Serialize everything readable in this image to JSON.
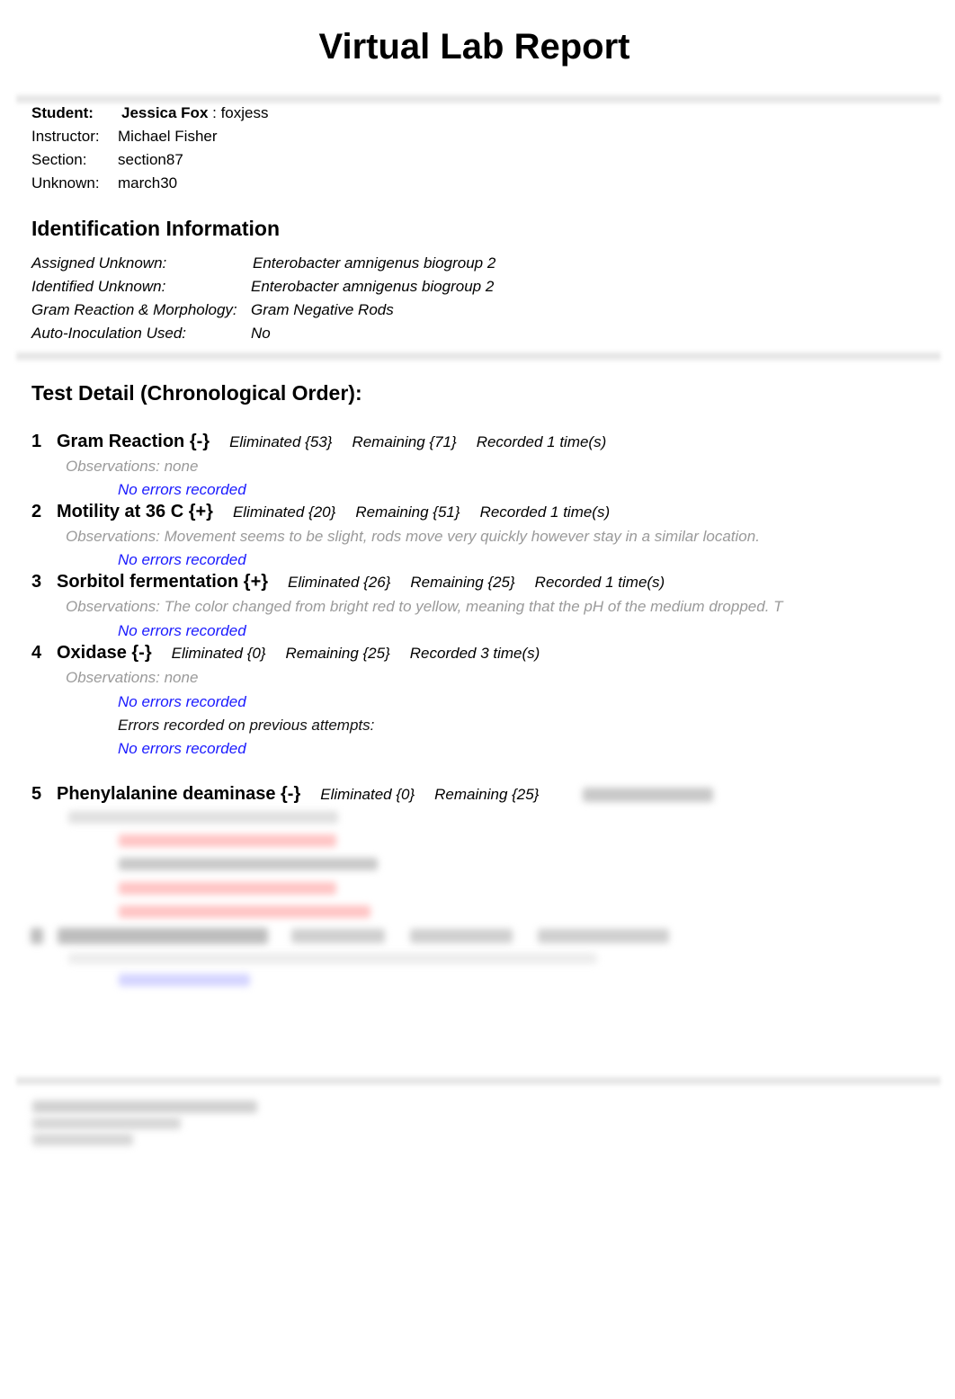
{
  "title": "Virtual Lab Report",
  "student_info": {
    "student_label": "Student:",
    "student_name": "Jessica Fox",
    "student_sep": " : ",
    "student_id": "foxjess",
    "instructor_label": "Instructor:",
    "instructor": "Michael Fisher",
    "section_label": "Section:",
    "section": "section87",
    "unknown_label": "Unknown:",
    "unknown": "march30"
  },
  "identification": {
    "heading": "Identification Information",
    "rows": [
      {
        "label": "Assigned Unknown:",
        "value": "Enterobacter amnigenus biogroup 2"
      },
      {
        "label": "Identified Unknown:",
        "value": "Enterobacter amnigenus biogroup 2"
      },
      {
        "label": "Gram Reaction & Morphology:",
        "value": "Gram Negative Rods"
      },
      {
        "label": "Auto-Inoculation Used:",
        "value": "No"
      }
    ]
  },
  "test_detail": {
    "heading": "Test Detail (Chronological Order):",
    "tests": [
      {
        "num": "1",
        "name": "Gram Reaction {-}",
        "eliminated": "Eliminated {53}",
        "remaining": "Remaining {71}",
        "recorded": "Recorded 1 time(s)",
        "observations": "Observations: none",
        "errors": "No errors recorded"
      },
      {
        "num": "2",
        "name": "Motility at 36 C {+}",
        "eliminated": "Eliminated {20}",
        "remaining": "Remaining {51}",
        "recorded": "Recorded 1 time(s)",
        "observations": "Observations: Movement seems to be slight, rods move very quickly however stay in a similar location.",
        "errors": "No errors recorded"
      },
      {
        "num": "3",
        "name": "Sorbitol fermentation {+}",
        "eliminated": "Eliminated {26}",
        "remaining": "Remaining {25}",
        "recorded": "Recorded 1 time(s)",
        "observations": "Observations: The color changed from bright red to yellow, meaning that the pH of the medium dropped. T",
        "errors": "No errors recorded"
      },
      {
        "num": "4",
        "name": "Oxidase {-}",
        "eliminated": "Eliminated {0}",
        "remaining": "Remaining {25}",
        "recorded": "Recorded 3 time(s)",
        "observations": "Observations: none",
        "errors": "No errors recorded",
        "previous_errors_label": "Errors recorded on previous attempts:",
        "previous_errors": "No errors recorded"
      },
      {
        "num": "5",
        "name": "Phenylalanine deaminase {-}",
        "eliminated": "Eliminated {0}",
        "remaining": "Remaining {25}"
      }
    ]
  },
  "colors": {
    "error_none": "#1a1aff",
    "observation": "#9a9a9a",
    "error_present": "#ff6b6b"
  }
}
